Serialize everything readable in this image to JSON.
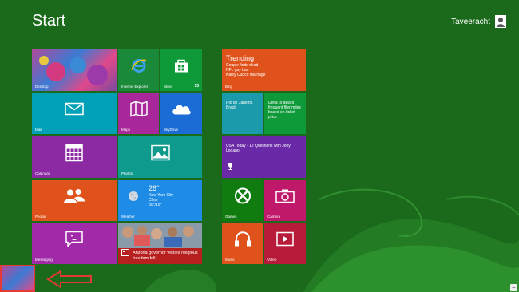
{
  "screen": {
    "title": "Start"
  },
  "user": {
    "name": "Taveeracht"
  },
  "colors": {
    "background": "#1b6a1b",
    "accent_red": "#e53935"
  },
  "tiles": {
    "desktop": {
      "label": "Desktop"
    },
    "ie": {
      "label": "Internet Explorer",
      "icon": "ie-icon"
    },
    "store": {
      "label": "Store",
      "badge": "15",
      "icon": "store-icon"
    },
    "mail": {
      "label": "Mail",
      "icon": "mail-icon"
    },
    "maps": {
      "label": "Maps",
      "icon": "map-icon"
    },
    "skydrive": {
      "label": "SkyDrive",
      "icon": "cloud-icon"
    },
    "calendar": {
      "label": "Calendar",
      "icon": "calendar-icon"
    },
    "photos": {
      "label": "Photos",
      "icon": "photo-icon"
    },
    "people": {
      "label": "People",
      "icon": "people-icon"
    },
    "weather": {
      "label": "Weather",
      "temp": "26°",
      "city": "New York City",
      "cond": "Clear",
      "range": "30°/15°"
    },
    "messaging": {
      "label": "Messaging",
      "icon": "chat-icon"
    },
    "news": {
      "headline": "Arizona governor vetoes religious freedom bill"
    },
    "bing": {
      "label": "Bing",
      "title": "Trending",
      "line1": "Couple finds dead",
      "line2": "NFL gay ban",
      "line3": "Kaley Cuoco marriage"
    },
    "travel": {
      "text": "Rio de Janeiro, Brazil"
    },
    "finance": {
      "text": "Delta to award frequent flier miles based on ticket price"
    },
    "sports": {
      "text": "USA Today - 12 Questions with Joey Logano"
    },
    "games": {
      "label": "Games",
      "icon": "xbox-icon"
    },
    "camera": {
      "label": "Camera",
      "icon": "camera-icon"
    },
    "music": {
      "label": "Music",
      "icon": "headphones-icon"
    },
    "video": {
      "label": "Video",
      "icon": "play-icon"
    }
  }
}
